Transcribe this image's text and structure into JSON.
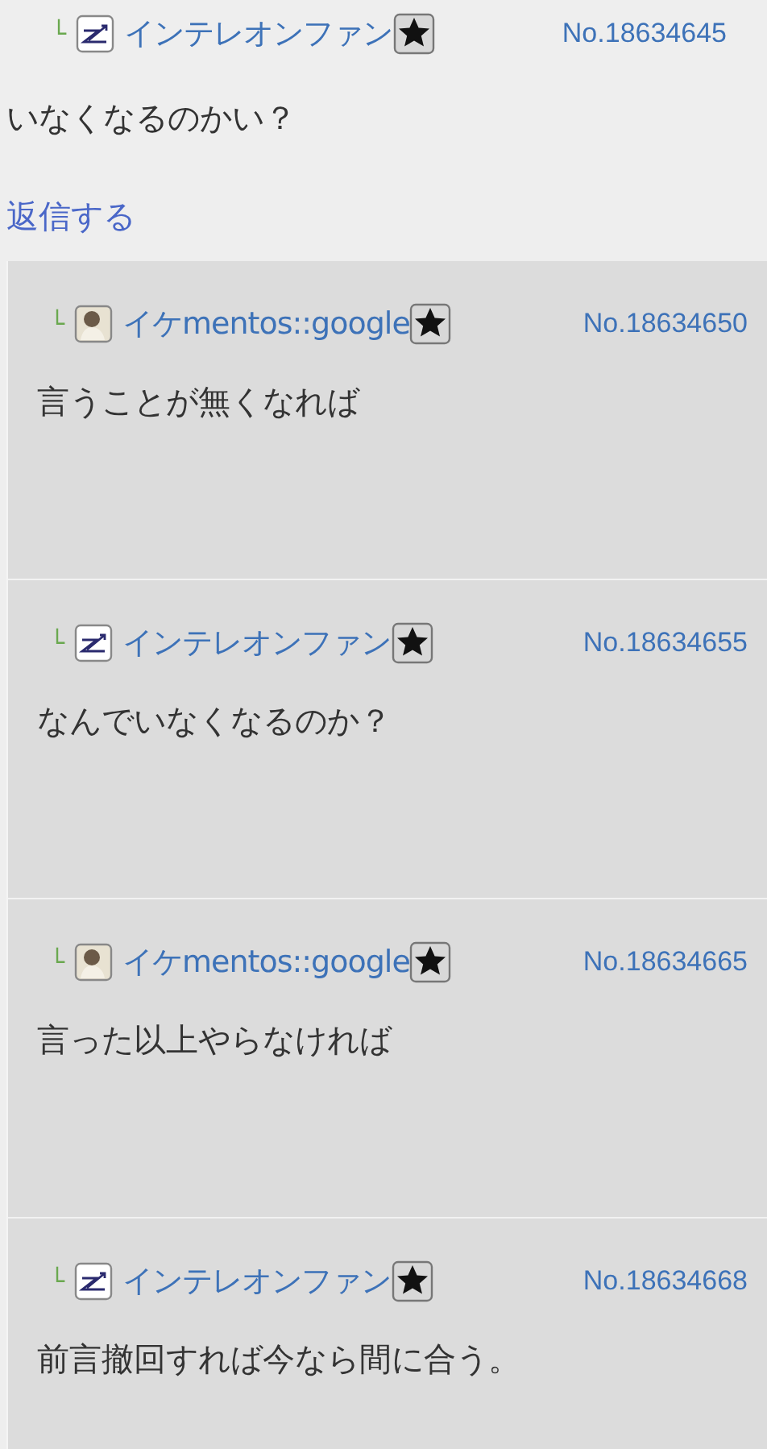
{
  "post": {
    "marker": "└",
    "author": "インテレオンファン",
    "avatar": {
      "kind": "chart"
    },
    "number": "No.18634645",
    "body": "いなくなるのかい？",
    "reply_link": "返信する"
  },
  "replies": [
    {
      "marker": "└",
      "author": "イケmentos::google",
      "avatar": {
        "kind": "photo"
      },
      "number": "No.18634650",
      "body": "言うことが無くなれば"
    },
    {
      "marker": "└",
      "author": "インテレオンファン",
      "avatar": {
        "kind": "chart"
      },
      "number": "No.18634655",
      "body": "なんでいなくなるのか？"
    },
    {
      "marker": "└",
      "author": "イケmentos::google",
      "avatar": {
        "kind": "photo"
      },
      "number": "No.18634665",
      "body": "言った以上やらなければ"
    },
    {
      "marker": "└",
      "author": "インテレオンファン",
      "avatar": {
        "kind": "chart"
      },
      "number": "No.18634668",
      "body": "前言撤回すれば今なら間に合う。"
    }
  ]
}
